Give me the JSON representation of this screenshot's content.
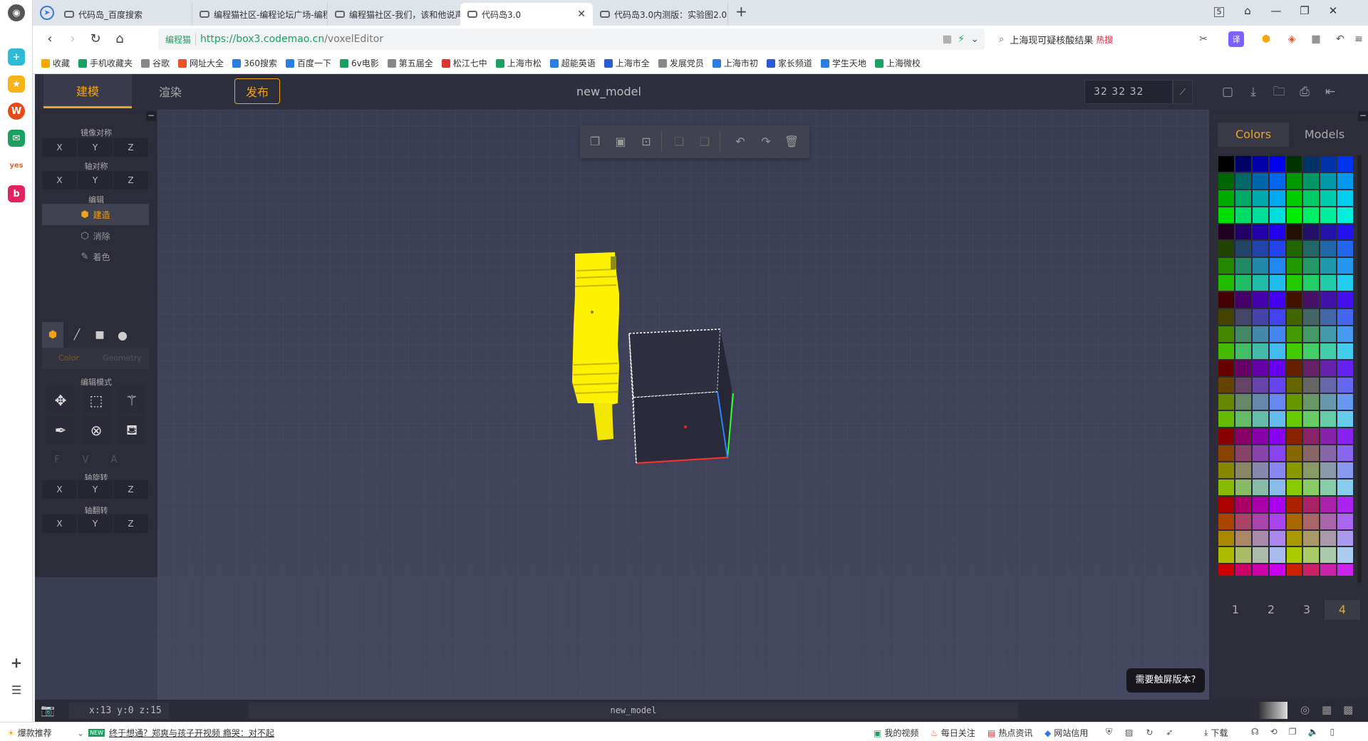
{
  "browser": {
    "tabs": [
      {
        "title": "代码岛_百度搜索"
      },
      {
        "title": "编程猫社区-编程论坛广场-编程"
      },
      {
        "title": "编程猫社区-我们，该和他说声再"
      },
      {
        "title": "代码岛3.0"
      },
      {
        "title": "代码岛3.0内测版：实验图2.0"
      }
    ],
    "tab_count": "5",
    "url": {
      "site_label": "编程猫",
      "scheme": "https://",
      "host": "box3.codemao.cn",
      "path": "/voxelEditor"
    },
    "search": {
      "text": "上海现可疑核酸结果",
      "hot_label": "热搜"
    },
    "bookmarks": [
      "收藏",
      "手机收藏夹",
      "谷歌",
      "网址大全",
      "360搜索",
      "百度一下",
      "6v电影",
      "第五届全",
      "松江七中",
      "上海市松",
      "超能英语",
      "上海市全",
      "发展党员",
      "上海市初",
      "家长频道",
      "学生天地",
      "上海微校"
    ]
  },
  "app": {
    "mode_tabs": {
      "build": "建模",
      "render": "渲染"
    },
    "publish_label": "发布",
    "model_name": "new_model",
    "size": {
      "x": "32",
      "y": "32",
      "z": "32"
    },
    "left_panel": {
      "mirror_heading": "镜像对称",
      "axis_sym_heading": "轴对称",
      "edit_heading": "编辑",
      "axes": {
        "x": "X",
        "y": "Y",
        "z": "Z"
      },
      "modes": {
        "build": "建造",
        "erase": "消除",
        "paint": "着色"
      },
      "color_label": "Color",
      "geometry_label": "Geometry",
      "edit_mode_heading": "编辑模式",
      "fva": {
        "f": "F",
        "v": "V",
        "a": "A"
      },
      "rotate_heading": "轴旋转",
      "flip_heading": "轴翻转"
    },
    "right_panel": {
      "tabs": {
        "colors": "Colors",
        "models": "Models"
      },
      "pages": [
        "1",
        "2",
        "3",
        "4"
      ],
      "active_page": "4",
      "palette": [
        "#000000",
        "#000066",
        "#0000aa",
        "#0000ee",
        "#003300",
        "#003366",
        "#0033aa",
        "#0033ee",
        "#006600",
        "#006666",
        "#0066aa",
        "#0066ee",
        "#009900",
        "#009966",
        "#0099aa",
        "#0099ee",
        "#00aa00",
        "#00aa66",
        "#00aaaa",
        "#00aaee",
        "#00cc00",
        "#00cc66",
        "#00ccaa",
        "#00ccee",
        "#00dd00",
        "#00dd66",
        "#00dd99",
        "#00dddd",
        "#00ee00",
        "#00ee66",
        "#00ee99",
        "#00eedd",
        "#220022",
        "#220066",
        "#2200aa",
        "#2200ee",
        "#221100",
        "#221166",
        "#2211aa",
        "#2211ee",
        "#224400",
        "#224466",
        "#2244aa",
        "#2244ee",
        "#226600",
        "#226666",
        "#2266aa",
        "#2266ee",
        "#228800",
        "#228866",
        "#2288aa",
        "#2288ee",
        "#229900",
        "#229966",
        "#2299aa",
        "#2299ee",
        "#22bb00",
        "#22bb66",
        "#22bbaa",
        "#22bbee",
        "#22cc00",
        "#22cc66",
        "#22ccaa",
        "#22ccee",
        "#440000",
        "#440066",
        "#4400aa",
        "#4400ee",
        "#441100",
        "#441166",
        "#4411aa",
        "#4411ee",
        "#444400",
        "#444466",
        "#4444aa",
        "#4444ee",
        "#446600",
        "#446666",
        "#4466aa",
        "#4466ee",
        "#448800",
        "#448866",
        "#4488aa",
        "#4488ee",
        "#449900",
        "#449966",
        "#4499aa",
        "#4499ee",
        "#44bb00",
        "#44bb66",
        "#44bbaa",
        "#44bbee",
        "#44cc00",
        "#44cc66",
        "#44ccaa",
        "#44ccee",
        "#660000",
        "#660066",
        "#6600aa",
        "#6600ee",
        "#662200",
        "#662266",
        "#6622aa",
        "#6622ee",
        "#664400",
        "#664466",
        "#6644aa",
        "#6644ee",
        "#666600",
        "#666666",
        "#6666aa",
        "#6666ee",
        "#668800",
        "#668866",
        "#6688aa",
        "#6688ee",
        "#669900",
        "#669966",
        "#6699aa",
        "#6699ee",
        "#66bb00",
        "#66bb66",
        "#66bbaa",
        "#66bbee",
        "#66cc00",
        "#66cc66",
        "#66ccaa",
        "#66ccee",
        "#880000",
        "#880066",
        "#8800aa",
        "#8800ee",
        "#882200",
        "#882266",
        "#8822aa",
        "#8822ee",
        "#884400",
        "#884466",
        "#8844aa",
        "#8844ee",
        "#886600",
        "#886666",
        "#8866aa",
        "#8866ee",
        "#888800",
        "#888866",
        "#8888aa",
        "#8888ee",
        "#889900",
        "#889966",
        "#8899aa",
        "#8899ee",
        "#88bb00",
        "#88bb66",
        "#88bbaa",
        "#88bbee",
        "#88cc00",
        "#88cc66",
        "#88ccaa",
        "#88ccee",
        "#aa0000",
        "#aa0066",
        "#aa00aa",
        "#aa00ee",
        "#aa2200",
        "#aa2266",
        "#aa22aa",
        "#aa22ee",
        "#aa4400",
        "#aa4466",
        "#aa44aa",
        "#aa44ee",
        "#aa6600",
        "#aa6666",
        "#aa66aa",
        "#aa66ee",
        "#aa8800",
        "#aa8866",
        "#aa88aa",
        "#aa88ee",
        "#aa9900",
        "#aa9966",
        "#aa99aa",
        "#aa99ee",
        "#aabb00",
        "#aabb66",
        "#aabbaa",
        "#aabbee",
        "#aacc00",
        "#aacc66",
        "#aaccaa",
        "#aaccee",
        "#cc0000",
        "#cc0066",
        "#cc00aa",
        "#cc00ee",
        "#cc2200",
        "#cc2266",
        "#cc22aa",
        "#cc22ee",
        "#cc4400",
        "#cc4466",
        "#cc44aa",
        "#cc44ee",
        "#cc6600",
        "#cc6666",
        "#cc66aa",
        "#cc66ee",
        "#cc8800",
        "#cc8866",
        "#cc88aa",
        "#cc88ee",
        "#cc9900",
        "#cc9966",
        "#cc99aa",
        "#cc99ee",
        "#ccbb00",
        "#ccbb66",
        "#ccbbaa",
        "#ccbbee",
        "#cccc00",
        "#cccc66",
        "#ccccaa",
        "#cccccc",
        "#ee0000",
        "#ee0066",
        "#ee00aa",
        "#ee00ee",
        "#ee2200",
        "#ee2266",
        "#ee22aa",
        "#ee22ee",
        "#ee4400",
        "#ee4466",
        "#ee44aa",
        "#ee44ee",
        "#ee6600",
        "#ee6666",
        "#ee66aa",
        "#ee66ee"
      ]
    },
    "status": {
      "coords": "x:13 y:0 z:15",
      "model_name": "new_model"
    },
    "touch_tip": "需要触屏版本?"
  },
  "bottom_bar": {
    "recommend": "爆款推荐",
    "news_badge": "NEW",
    "news_text": "终于想通？郑爽与孩子开视频 瘾哭：对不起",
    "items": [
      "我的视频",
      "每日关注",
      "热点资讯",
      "网站信用",
      "下载"
    ]
  },
  "colors": {
    "accent": "#f0a318",
    "model_yellow": "#ffee00"
  }
}
